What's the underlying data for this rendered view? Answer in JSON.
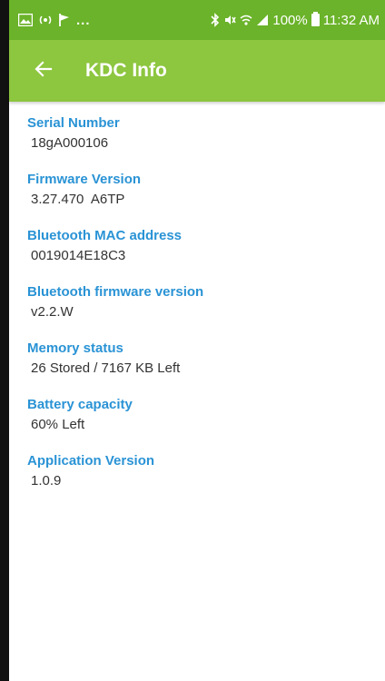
{
  "status_bar": {
    "left_icons": [
      "image-icon",
      "hotspot-icon",
      "flag-icon"
    ],
    "dots": "...",
    "right_icons": [
      "bluetooth-icon",
      "mute-icon",
      "wifi-icon",
      "signal-icon"
    ],
    "battery": "100%",
    "time": "11:32 AM"
  },
  "app_bar": {
    "back_icon": "arrow-back-icon",
    "title": "KDC Info"
  },
  "info": [
    {
      "label": "Serial Number",
      "value": "18gA000106"
    },
    {
      "label": "Firmware Version",
      "value": "3.27.470  A6TP"
    },
    {
      "label": "Bluetooth MAC address",
      "value": "0019014E18C3"
    },
    {
      "label": "Bluetooth firmware version",
      "value": "v2.2.W"
    },
    {
      "label": "Memory status",
      "value": "26 Stored / 7167 KB Left"
    },
    {
      "label": "Battery capacity",
      "value": "60% Left"
    },
    {
      "label": "Application Version",
      "value": "1.0.9"
    }
  ],
  "colors": {
    "status_bar": "#6bb32a",
    "app_bar": "#8dc63f",
    "label": "#2a93d5",
    "value": "#333333"
  }
}
